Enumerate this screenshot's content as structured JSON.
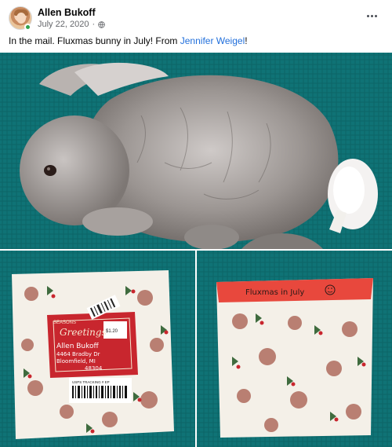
{
  "post": {
    "author": "Allen Bukoff",
    "date": "July 22, 2020",
    "privacy_icon": "globe-icon",
    "more_icon": "more-options-icon",
    "text_before": "In the mail. Fluxmas bunny in July! From ",
    "tagged_person": "Jennifer Weigel",
    "text_after": "!"
  },
  "photos": {
    "main": {
      "subject": "plush-bunny-on-teal-blanket"
    },
    "left": {
      "subject": "holiday-mailer-package-front",
      "label_text": "Greetings",
      "label_header": "SEASONS",
      "address_line1": "Allen Bukoff",
      "address_line2": "4464 Bradby Dr",
      "address_line3": "Bloomfield, MI",
      "address_line4": "48304",
      "tracking_label": "USPS TRACKING # EP",
      "stamp_text": "$1.20"
    },
    "right": {
      "subject": "holiday-mailer-package-back",
      "flap_text": "Fluxmas in July"
    }
  },
  "colors": {
    "link": "#216fdb",
    "blanket_teal": "#0f7376",
    "label_red": "#c8262e"
  }
}
